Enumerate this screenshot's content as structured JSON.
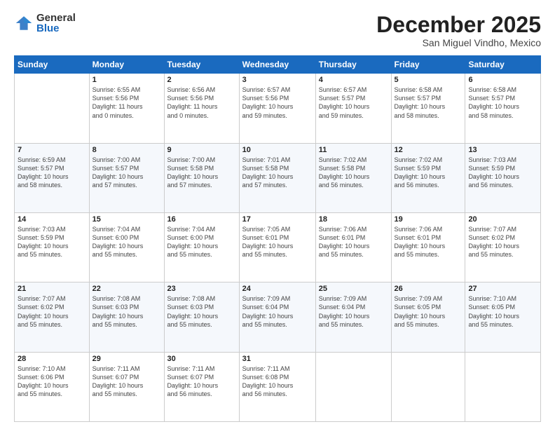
{
  "logo": {
    "general": "General",
    "blue": "Blue"
  },
  "header": {
    "month": "December 2025",
    "location": "San Miguel Vindho, Mexico"
  },
  "days": [
    "Sunday",
    "Monday",
    "Tuesday",
    "Wednesday",
    "Thursday",
    "Friday",
    "Saturday"
  ],
  "weeks": [
    [
      {
        "day": "",
        "text": ""
      },
      {
        "day": "1",
        "text": "Sunrise: 6:55 AM\nSunset: 5:56 PM\nDaylight: 11 hours\nand 0 minutes."
      },
      {
        "day": "2",
        "text": "Sunrise: 6:56 AM\nSunset: 5:56 PM\nDaylight: 11 hours\nand 0 minutes."
      },
      {
        "day": "3",
        "text": "Sunrise: 6:57 AM\nSunset: 5:56 PM\nDaylight: 10 hours\nand 59 minutes."
      },
      {
        "day": "4",
        "text": "Sunrise: 6:57 AM\nSunset: 5:57 PM\nDaylight: 10 hours\nand 59 minutes."
      },
      {
        "day": "5",
        "text": "Sunrise: 6:58 AM\nSunset: 5:57 PM\nDaylight: 10 hours\nand 58 minutes."
      },
      {
        "day": "6",
        "text": "Sunrise: 6:58 AM\nSunset: 5:57 PM\nDaylight: 10 hours\nand 58 minutes."
      }
    ],
    [
      {
        "day": "7",
        "text": "Sunrise: 6:59 AM\nSunset: 5:57 PM\nDaylight: 10 hours\nand 58 minutes."
      },
      {
        "day": "8",
        "text": "Sunrise: 7:00 AM\nSunset: 5:57 PM\nDaylight: 10 hours\nand 57 minutes."
      },
      {
        "day": "9",
        "text": "Sunrise: 7:00 AM\nSunset: 5:58 PM\nDaylight: 10 hours\nand 57 minutes."
      },
      {
        "day": "10",
        "text": "Sunrise: 7:01 AM\nSunset: 5:58 PM\nDaylight: 10 hours\nand 57 minutes."
      },
      {
        "day": "11",
        "text": "Sunrise: 7:02 AM\nSunset: 5:58 PM\nDaylight: 10 hours\nand 56 minutes."
      },
      {
        "day": "12",
        "text": "Sunrise: 7:02 AM\nSunset: 5:59 PM\nDaylight: 10 hours\nand 56 minutes."
      },
      {
        "day": "13",
        "text": "Sunrise: 7:03 AM\nSunset: 5:59 PM\nDaylight: 10 hours\nand 56 minutes."
      }
    ],
    [
      {
        "day": "14",
        "text": "Sunrise: 7:03 AM\nSunset: 5:59 PM\nDaylight: 10 hours\nand 55 minutes."
      },
      {
        "day": "15",
        "text": "Sunrise: 7:04 AM\nSunset: 6:00 PM\nDaylight: 10 hours\nand 55 minutes."
      },
      {
        "day": "16",
        "text": "Sunrise: 7:04 AM\nSunset: 6:00 PM\nDaylight: 10 hours\nand 55 minutes."
      },
      {
        "day": "17",
        "text": "Sunrise: 7:05 AM\nSunset: 6:01 PM\nDaylight: 10 hours\nand 55 minutes."
      },
      {
        "day": "18",
        "text": "Sunrise: 7:06 AM\nSunset: 6:01 PM\nDaylight: 10 hours\nand 55 minutes."
      },
      {
        "day": "19",
        "text": "Sunrise: 7:06 AM\nSunset: 6:01 PM\nDaylight: 10 hours\nand 55 minutes."
      },
      {
        "day": "20",
        "text": "Sunrise: 7:07 AM\nSunset: 6:02 PM\nDaylight: 10 hours\nand 55 minutes."
      }
    ],
    [
      {
        "day": "21",
        "text": "Sunrise: 7:07 AM\nSunset: 6:02 PM\nDaylight: 10 hours\nand 55 minutes."
      },
      {
        "day": "22",
        "text": "Sunrise: 7:08 AM\nSunset: 6:03 PM\nDaylight: 10 hours\nand 55 minutes."
      },
      {
        "day": "23",
        "text": "Sunrise: 7:08 AM\nSunset: 6:03 PM\nDaylight: 10 hours\nand 55 minutes."
      },
      {
        "day": "24",
        "text": "Sunrise: 7:09 AM\nSunset: 6:04 PM\nDaylight: 10 hours\nand 55 minutes."
      },
      {
        "day": "25",
        "text": "Sunrise: 7:09 AM\nSunset: 6:04 PM\nDaylight: 10 hours\nand 55 minutes."
      },
      {
        "day": "26",
        "text": "Sunrise: 7:09 AM\nSunset: 6:05 PM\nDaylight: 10 hours\nand 55 minutes."
      },
      {
        "day": "27",
        "text": "Sunrise: 7:10 AM\nSunset: 6:05 PM\nDaylight: 10 hours\nand 55 minutes."
      }
    ],
    [
      {
        "day": "28",
        "text": "Sunrise: 7:10 AM\nSunset: 6:06 PM\nDaylight: 10 hours\nand 55 minutes."
      },
      {
        "day": "29",
        "text": "Sunrise: 7:11 AM\nSunset: 6:07 PM\nDaylight: 10 hours\nand 55 minutes."
      },
      {
        "day": "30",
        "text": "Sunrise: 7:11 AM\nSunset: 6:07 PM\nDaylight: 10 hours\nand 56 minutes."
      },
      {
        "day": "31",
        "text": "Sunrise: 7:11 AM\nSunset: 6:08 PM\nDaylight: 10 hours\nand 56 minutes."
      },
      {
        "day": "",
        "text": ""
      },
      {
        "day": "",
        "text": ""
      },
      {
        "day": "",
        "text": ""
      }
    ]
  ]
}
